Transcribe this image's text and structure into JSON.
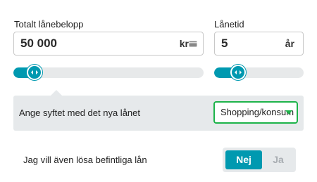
{
  "loan_amount": {
    "label": "Totalt lånebelopp",
    "value": "50 000",
    "unit": "kr",
    "slider_fraction": 0.11
  },
  "loan_term": {
    "label": "Lånetid",
    "value": "5",
    "unit": "år",
    "slider_fraction": 0.27
  },
  "purpose": {
    "label": "Ange syftet med det nya lånet",
    "selected": "Shopping/konsum"
  },
  "refinance": {
    "label": "Jag vill även lösa befintliga lån",
    "options": [
      "Nej",
      "Ja"
    ],
    "selected": "Nej"
  },
  "colors": {
    "accent": "#0099b0",
    "select_border": "#1db34a",
    "panel_bg": "#e6e9eb"
  }
}
